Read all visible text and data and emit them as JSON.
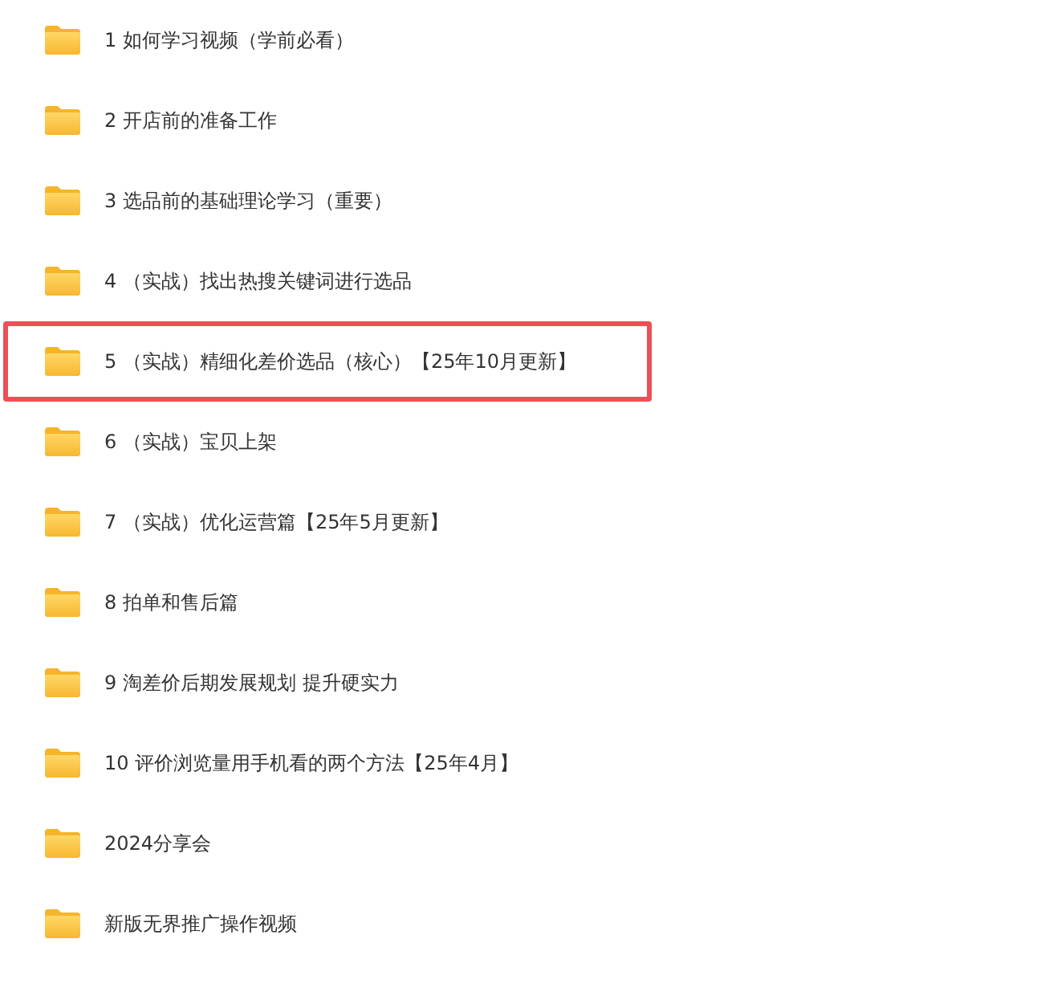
{
  "folders": [
    {
      "name": "1 如何学习视频（学前必看）",
      "highlighted": false
    },
    {
      "name": "2 开店前的准备工作",
      "highlighted": false
    },
    {
      "name": "3 选品前的基础理论学习（重要）",
      "highlighted": false
    },
    {
      "name": "4 （实战）找出热搜关键词进行选品",
      "highlighted": false
    },
    {
      "name": "5 （实战）精细化差价选品（核心）【25年10月更新】",
      "highlighted": true
    },
    {
      "name": "6 （实战）宝贝上架",
      "highlighted": false
    },
    {
      "name": "7 （实战）优化运营篇【25年5月更新】",
      "highlighted": false
    },
    {
      "name": "8 拍单和售后篇",
      "highlighted": false
    },
    {
      "name": "9 淘差价后期发展规划 提升硬实力",
      "highlighted": false
    },
    {
      "name": "10 评价浏览量用手机看的两个方法【25年4月】",
      "highlighted": false
    },
    {
      "name": "2024分享会",
      "highlighted": false
    },
    {
      "name": "新版无界推广操作视频",
      "highlighted": false
    }
  ]
}
